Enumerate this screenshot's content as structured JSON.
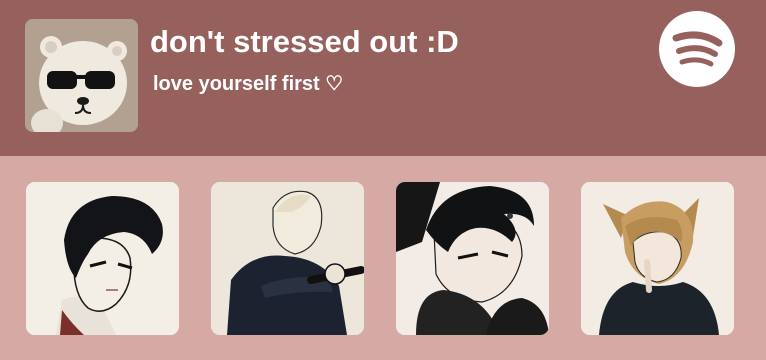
{
  "playlist": {
    "title": "don't stressed out :D",
    "subtitle": "love yourself first ♡",
    "cover_image": "bear-with-sunglasses-cover",
    "logo_icon": "spotify-icon"
  },
  "colors": {
    "header_bg": "#96605d",
    "page_bg": "#d6aaa4",
    "text": "#ffffff"
  },
  "tiles": [
    {
      "image": "dark-haired-character-artwork"
    },
    {
      "image": "blond-character-with-mic-artwork"
    },
    {
      "image": "character-in-hoodie-artwork"
    },
    {
      "image": "fox-eared-character-artwork"
    }
  ]
}
